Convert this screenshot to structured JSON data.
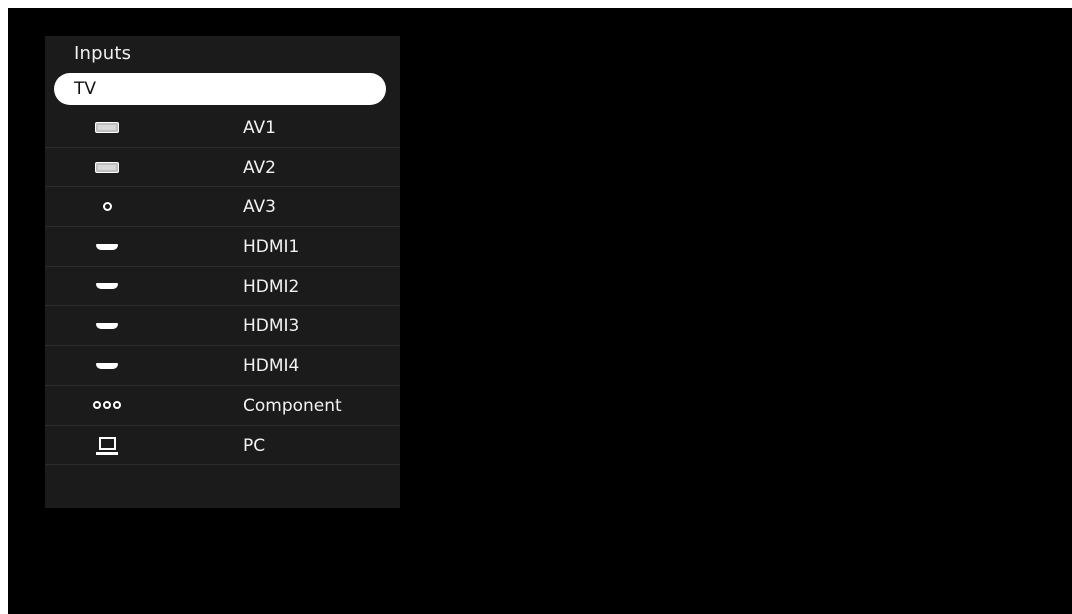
{
  "panel": {
    "title": "Inputs",
    "selected": "TV",
    "items": [
      {
        "label": "AV1",
        "icon": "scart-icon"
      },
      {
        "label": "AV2",
        "icon": "scart-icon"
      },
      {
        "label": "AV3",
        "icon": "rca-icon"
      },
      {
        "label": "HDMI1",
        "icon": "hdmi-icon"
      },
      {
        "label": "HDMI2",
        "icon": "hdmi-icon"
      },
      {
        "label": "HDMI3",
        "icon": "hdmi-icon"
      },
      {
        "label": "HDMI4",
        "icon": "hdmi-icon"
      },
      {
        "label": "Component",
        "icon": "component-icon"
      },
      {
        "label": "PC",
        "icon": "pc-icon"
      }
    ]
  },
  "colors": {
    "background": "#000000",
    "panel": "#1b1b1b",
    "highlight": "#ffffff",
    "text": "#f2f2f2"
  }
}
